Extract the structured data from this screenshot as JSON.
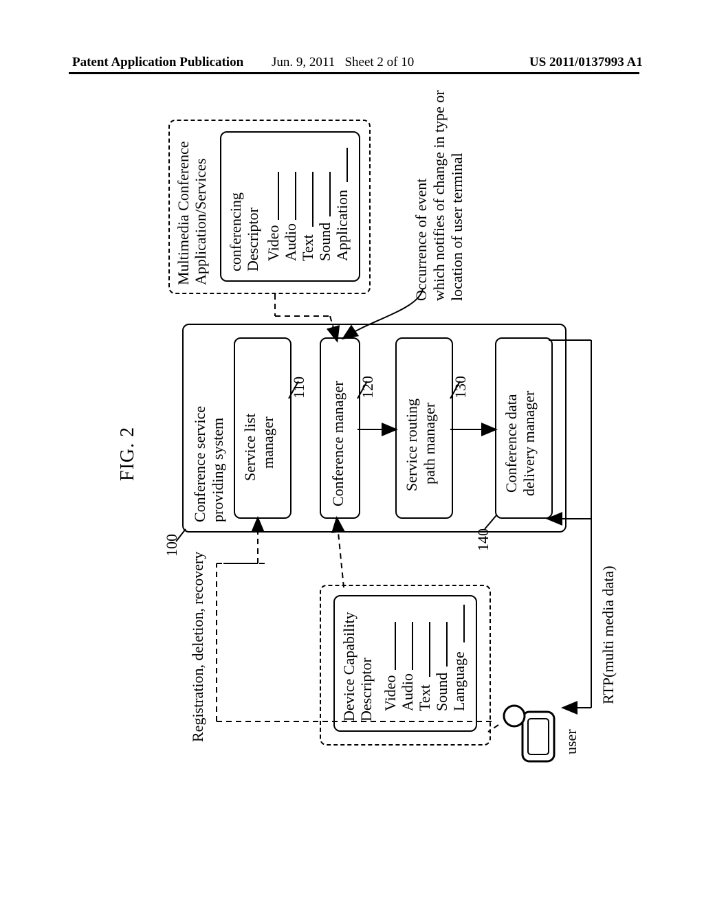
{
  "header": {
    "left": "Patent Application Publication",
    "mid_date": "Jun. 9, 2011",
    "mid_sheet": "Sheet 2 of 10",
    "right": "US 2011/0137993 A1"
  },
  "fig_title": "FIG. 2",
  "labels": {
    "reg_del_rec": "Registration, deletion, recovery",
    "user_caption": "user",
    "rtp": "RTP(multi media data)",
    "event_line1": "Occurrence of event",
    "event_line2": "which notifies of change in type or",
    "event_line3": "location of user terminal"
  },
  "device_cap": {
    "title": "Device Capability",
    "title2": "Descriptor",
    "video": "Video",
    "audio": "Audio",
    "text": "Text",
    "sound": "Sound",
    "language": "Language"
  },
  "conf_app": {
    "title1": "Multimedia Conference",
    "title2": "Application/Services",
    "d1": "conferencing",
    "d2": "Descriptor",
    "v1": "Video",
    "v2": "Audio",
    "v3": "Text",
    "v4": "Sound",
    "v5": "Application"
  },
  "system": {
    "ref": "100",
    "title1": "Conference service",
    "title2": "providing system",
    "b110_ref": "110",
    "b110_l1": "Service list",
    "b110_l2": "manager",
    "b120_ref": "120",
    "b120": "Conference manager",
    "b130_ref": "130",
    "b130_l1": "Service routing",
    "b130_l2": "path manager",
    "b140_ref": "140",
    "b140_l1": "Conference data",
    "b140_l2": "delivery manager"
  }
}
